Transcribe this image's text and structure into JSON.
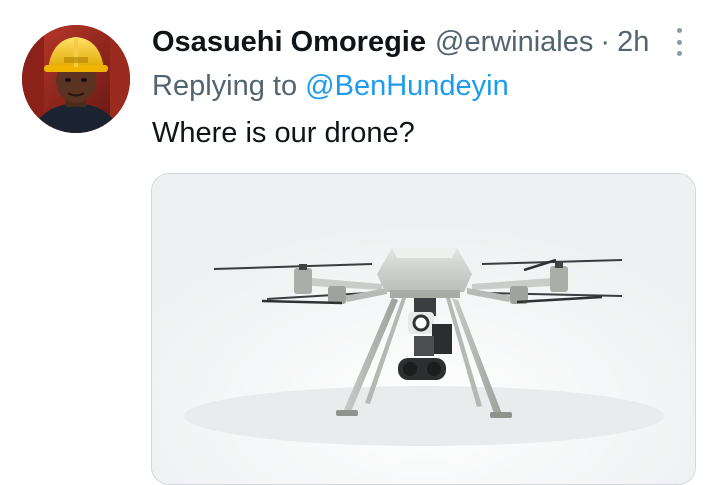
{
  "tweet": {
    "display_name": "Osasuehi Omoregie",
    "handle": "@erwiniales",
    "separator": "·",
    "timestamp": "2h",
    "reply_prefix": "Replying to",
    "reply_to": "@BenHundeyin",
    "text": "Where is our drone?"
  },
  "icons": {
    "more": "more-vertical-icon",
    "avatar": "profile-photo",
    "media": "drone-photo"
  },
  "colors": {
    "name": "#0f1419",
    "secondary": "#536471",
    "link": "#1d9bf0",
    "border": "#cfd9de"
  }
}
